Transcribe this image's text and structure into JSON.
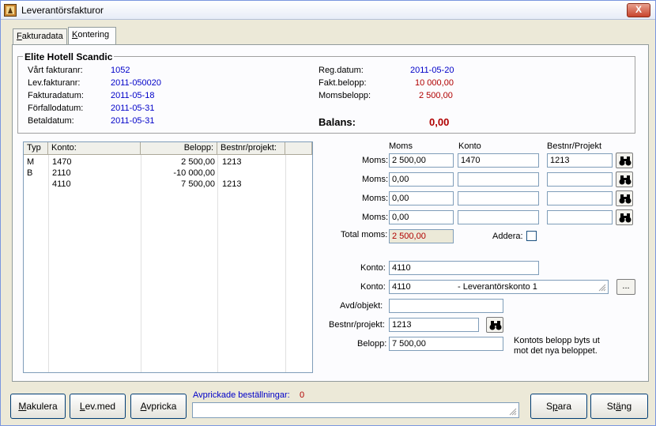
{
  "window": {
    "title": "Leverantörsfakturor",
    "close_label": "X"
  },
  "tabs": [
    {
      "hotkey": "F",
      "rest": "akturadata"
    },
    {
      "hotkey": "K",
      "rest": "ontering"
    }
  ],
  "header": {
    "company": "Elite Hotell Scandic",
    "left": [
      {
        "label": "Vårt fakturanr:",
        "value": "1052"
      },
      {
        "label": "Lev.fakturanr:",
        "value": "2011-050020"
      },
      {
        "label": "Fakturadatum:",
        "value": "2011-05-18"
      },
      {
        "label": "Förfallodatum:",
        "value": "2011-05-31"
      },
      {
        "label": "Betaldatum:",
        "value": "2011-05-31"
      }
    ],
    "right": [
      {
        "label": "Reg.datum:",
        "value": "2011-05-20"
      },
      {
        "label": "Fakt.belopp:",
        "value": "10 000,00"
      },
      {
        "label": "Momsbelopp:",
        "value": "2 500,00"
      }
    ],
    "balans_label": "Balans:",
    "balans_value": "0,00"
  },
  "grid": {
    "columns": [
      "Typ",
      "Konto:",
      "Belopp:",
      "Bestnr/projekt:"
    ],
    "rows": [
      {
        "typ": "M",
        "konto": "1470",
        "belopp": "2 500,00",
        "bestnr": "1213"
      },
      {
        "typ": "B",
        "konto": "2110",
        "belopp": "-10 000,00",
        "bestnr": ""
      },
      {
        "typ": "",
        "konto": "4110",
        "belopp": "7 500,00",
        "bestnr": "1213"
      }
    ]
  },
  "moms": {
    "col_moms": "Moms",
    "col_konto": "Konto",
    "col_bestnr": "Bestnr/Projekt",
    "row_label": "Moms:",
    "rows": [
      {
        "moms": "2 500,00",
        "konto": "1470",
        "bestnr": "1213"
      },
      {
        "moms": "0,00",
        "konto": "",
        "bestnr": ""
      },
      {
        "moms": "0,00",
        "konto": "",
        "bestnr": ""
      },
      {
        "moms": "0,00",
        "konto": "",
        "bestnr": ""
      }
    ],
    "total_label": "Total moms:",
    "total_value": "2 500,00",
    "addera_label": "Addera:"
  },
  "form": {
    "konto_label": "Konto:",
    "konto_value": "4110",
    "konto2_label": "Konto:",
    "konto2_code": "4110",
    "konto2_name": "- Leverantörskonto 1",
    "ellipsis": "...",
    "avd_label": "Avd/objekt:",
    "avd_value": "",
    "bestnr_label": "Bestnr/projekt:",
    "bestnr_value": "1213",
    "belopp_label": "Belopp:",
    "belopp_value": "7 500,00",
    "note_line1": "Kontots belopp byts ut",
    "note_line2": "mot det nya beloppet."
  },
  "footer": {
    "makulera": {
      "hotkey": "M",
      "rest": "akulera"
    },
    "levmed": {
      "pre": "",
      "hotkey": "L",
      "rest": "ev.med"
    },
    "avpricka": {
      "hotkey": "A",
      "rest": "vpricka"
    },
    "avprickade_label": "Avprickade beställningar:",
    "avprickade_count": "0",
    "avprickade_value": "",
    "spara": {
      "pre": "S",
      "hotkey": "p",
      "rest": "ara"
    },
    "stang": {
      "pre": "St",
      "hotkey": "ä",
      "rest": "ng"
    }
  },
  "colors": {
    "accent_blue": "#0000c8",
    "accent_red": "#b00000",
    "window_bg": "#ece9d8"
  }
}
